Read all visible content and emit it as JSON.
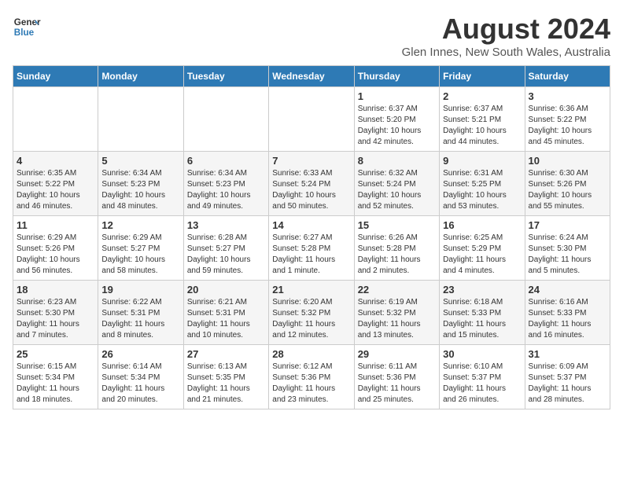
{
  "header": {
    "logo_line1": "General",
    "logo_line2": "Blue",
    "month_year": "August 2024",
    "location": "Glen Innes, New South Wales, Australia"
  },
  "weekdays": [
    "Sunday",
    "Monday",
    "Tuesday",
    "Wednesday",
    "Thursday",
    "Friday",
    "Saturday"
  ],
  "weeks": [
    [
      {
        "day": "",
        "info": ""
      },
      {
        "day": "",
        "info": ""
      },
      {
        "day": "",
        "info": ""
      },
      {
        "day": "",
        "info": ""
      },
      {
        "day": "1",
        "info": "Sunrise: 6:37 AM\nSunset: 5:20 PM\nDaylight: 10 hours\nand 42 minutes."
      },
      {
        "day": "2",
        "info": "Sunrise: 6:37 AM\nSunset: 5:21 PM\nDaylight: 10 hours\nand 44 minutes."
      },
      {
        "day": "3",
        "info": "Sunrise: 6:36 AM\nSunset: 5:22 PM\nDaylight: 10 hours\nand 45 minutes."
      }
    ],
    [
      {
        "day": "4",
        "info": "Sunrise: 6:35 AM\nSunset: 5:22 PM\nDaylight: 10 hours\nand 46 minutes."
      },
      {
        "day": "5",
        "info": "Sunrise: 6:34 AM\nSunset: 5:23 PM\nDaylight: 10 hours\nand 48 minutes."
      },
      {
        "day": "6",
        "info": "Sunrise: 6:34 AM\nSunset: 5:23 PM\nDaylight: 10 hours\nand 49 minutes."
      },
      {
        "day": "7",
        "info": "Sunrise: 6:33 AM\nSunset: 5:24 PM\nDaylight: 10 hours\nand 50 minutes."
      },
      {
        "day": "8",
        "info": "Sunrise: 6:32 AM\nSunset: 5:24 PM\nDaylight: 10 hours\nand 52 minutes."
      },
      {
        "day": "9",
        "info": "Sunrise: 6:31 AM\nSunset: 5:25 PM\nDaylight: 10 hours\nand 53 minutes."
      },
      {
        "day": "10",
        "info": "Sunrise: 6:30 AM\nSunset: 5:26 PM\nDaylight: 10 hours\nand 55 minutes."
      }
    ],
    [
      {
        "day": "11",
        "info": "Sunrise: 6:29 AM\nSunset: 5:26 PM\nDaylight: 10 hours\nand 56 minutes."
      },
      {
        "day": "12",
        "info": "Sunrise: 6:29 AM\nSunset: 5:27 PM\nDaylight: 10 hours\nand 58 minutes."
      },
      {
        "day": "13",
        "info": "Sunrise: 6:28 AM\nSunset: 5:27 PM\nDaylight: 10 hours\nand 59 minutes."
      },
      {
        "day": "14",
        "info": "Sunrise: 6:27 AM\nSunset: 5:28 PM\nDaylight: 11 hours\nand 1 minute."
      },
      {
        "day": "15",
        "info": "Sunrise: 6:26 AM\nSunset: 5:28 PM\nDaylight: 11 hours\nand 2 minutes."
      },
      {
        "day": "16",
        "info": "Sunrise: 6:25 AM\nSunset: 5:29 PM\nDaylight: 11 hours\nand 4 minutes."
      },
      {
        "day": "17",
        "info": "Sunrise: 6:24 AM\nSunset: 5:30 PM\nDaylight: 11 hours\nand 5 minutes."
      }
    ],
    [
      {
        "day": "18",
        "info": "Sunrise: 6:23 AM\nSunset: 5:30 PM\nDaylight: 11 hours\nand 7 minutes."
      },
      {
        "day": "19",
        "info": "Sunrise: 6:22 AM\nSunset: 5:31 PM\nDaylight: 11 hours\nand 8 minutes."
      },
      {
        "day": "20",
        "info": "Sunrise: 6:21 AM\nSunset: 5:31 PM\nDaylight: 11 hours\nand 10 minutes."
      },
      {
        "day": "21",
        "info": "Sunrise: 6:20 AM\nSunset: 5:32 PM\nDaylight: 11 hours\nand 12 minutes."
      },
      {
        "day": "22",
        "info": "Sunrise: 6:19 AM\nSunset: 5:32 PM\nDaylight: 11 hours\nand 13 minutes."
      },
      {
        "day": "23",
        "info": "Sunrise: 6:18 AM\nSunset: 5:33 PM\nDaylight: 11 hours\nand 15 minutes."
      },
      {
        "day": "24",
        "info": "Sunrise: 6:16 AM\nSunset: 5:33 PM\nDaylight: 11 hours\nand 16 minutes."
      }
    ],
    [
      {
        "day": "25",
        "info": "Sunrise: 6:15 AM\nSunset: 5:34 PM\nDaylight: 11 hours\nand 18 minutes."
      },
      {
        "day": "26",
        "info": "Sunrise: 6:14 AM\nSunset: 5:34 PM\nDaylight: 11 hours\nand 20 minutes."
      },
      {
        "day": "27",
        "info": "Sunrise: 6:13 AM\nSunset: 5:35 PM\nDaylight: 11 hours\nand 21 minutes."
      },
      {
        "day": "28",
        "info": "Sunrise: 6:12 AM\nSunset: 5:36 PM\nDaylight: 11 hours\nand 23 minutes."
      },
      {
        "day": "29",
        "info": "Sunrise: 6:11 AM\nSunset: 5:36 PM\nDaylight: 11 hours\nand 25 minutes."
      },
      {
        "day": "30",
        "info": "Sunrise: 6:10 AM\nSunset: 5:37 PM\nDaylight: 11 hours\nand 26 minutes."
      },
      {
        "day": "31",
        "info": "Sunrise: 6:09 AM\nSunset: 5:37 PM\nDaylight: 11 hours\nand 28 minutes."
      }
    ]
  ]
}
